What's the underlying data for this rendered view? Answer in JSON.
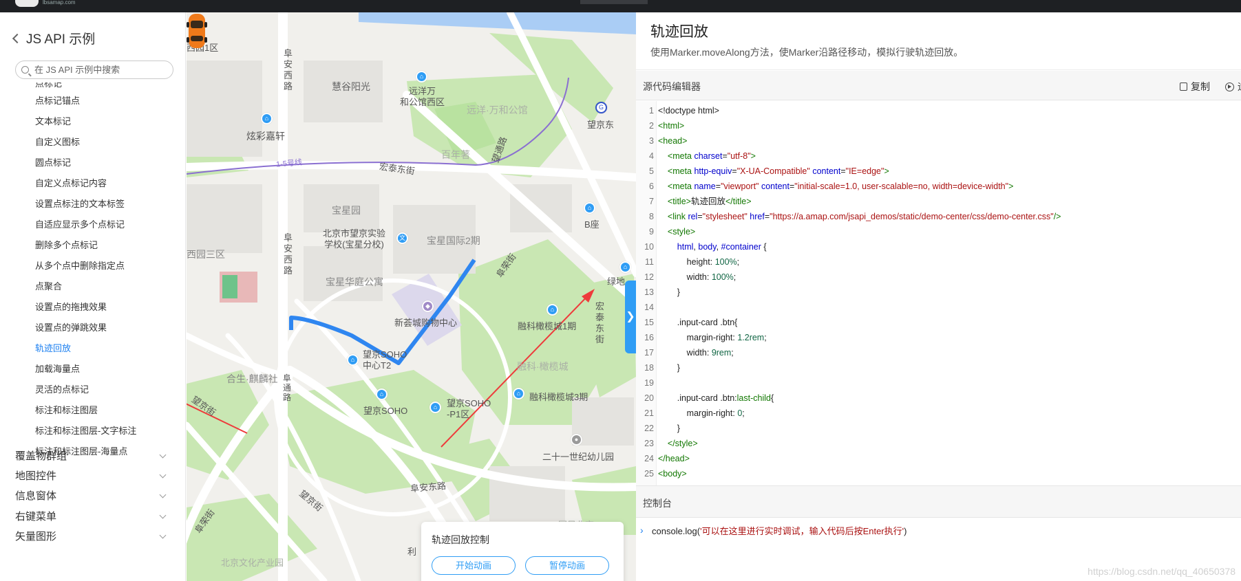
{
  "topbar": {
    "logo_text": "lbsamap.com"
  },
  "sidebar": {
    "back_title": "JS API 示例",
    "search_placeholder": "在 JS API 示例中搜索",
    "partial_item": "点标记",
    "items": [
      {
        "label": "点标记锚点"
      },
      {
        "label": "文本标记"
      },
      {
        "label": "自定义图标"
      },
      {
        "label": "圆点标记"
      },
      {
        "label": "自定义点标记内容"
      },
      {
        "label": "设置点标注的文本标签"
      },
      {
        "label": "自适应显示多个点标记"
      },
      {
        "label": "删除多个点标记"
      },
      {
        "label": "从多个点中删除指定点"
      },
      {
        "label": "点聚合"
      },
      {
        "label": "设置点的拖拽效果"
      },
      {
        "label": "设置点的弹跳效果"
      },
      {
        "label": "轨迹回放",
        "active": true
      },
      {
        "label": "加载海量点"
      },
      {
        "label": "灵活的点标记"
      },
      {
        "label": "标注和标注图层"
      },
      {
        "label": "标注和标注图层-文字标注"
      },
      {
        "label": "标注和标注图层-海量点"
      }
    ],
    "groups": [
      "覆盖物群组",
      "地图控件",
      "信息窗体",
      "右键菜单",
      "矢量图形"
    ]
  },
  "map": {
    "labels": {
      "l1": "西园1区",
      "l2": "阜安西路",
      "l3": "慧谷阳光",
      "l4": "远洋万\n和公馆西区",
      "l5": "远洋·万和公馆",
      "l6": "望京东",
      "l7": "炫彩嘉轩",
      "l8": "百年著",
      "l9": "望通路",
      "l10": "1·5号线",
      "l11": "宏泰东街",
      "l12": "宝星园",
      "l13": "B座",
      "l14": "北京市望京实验\n学校(宝星分校)",
      "l15": "宝星国际2期",
      "l16": "西园三区",
      "l17": "阜安西路",
      "l18": "宝星华庭公寓",
      "l19": "阜荣街",
      "l20": "绿地",
      "l21": "新荟城购物中心",
      "l22": "融科橄榄城1期",
      "l23": "宏泰东街",
      "l24": "望京SOHO\n中心T2",
      "l25": "融科·橄榄城",
      "l26": "合生·麒麟社",
      "l27": "望京街",
      "l28": "阜通路",
      "l29": "望京SOHO",
      "l30": "望京SOHO\n-P1区",
      "l31": "融科橄榄城3期",
      "l32": "二十一世纪幼儿园",
      "l33": "阜安东路",
      "l34": "望京街",
      "l35": "阜荣街",
      "l36": "利",
      "l37": "北京文化产业园",
      "l38": "国风北京"
    },
    "control_card": {
      "title": "轨迹回放控制",
      "start_button": "开始动画",
      "pause_button": "暂停动画"
    }
  },
  "right": {
    "title": "轨迹回放",
    "description": "使用Marker.moveAlong方法，使Marker沿路径移动，模拟行驶轨迹回放。",
    "editor_label": "源代码编辑器",
    "copy_label": "复制",
    "run_label": "运",
    "console_label": "控制台",
    "console_prefix": "console.log(",
    "console_string": "'可以在这里进行实时调试，输入代码后按Enter执行'",
    "console_suffix": ")",
    "watermark": "https://blog.csdn.net/qq_40650378"
  },
  "code_lines": [
    [
      [
        "tk-txt",
        "<!doctype html>"
      ]
    ],
    [
      [
        "tk-tag",
        "<html>"
      ]
    ],
    [
      [
        "tk-tag",
        "<head>"
      ]
    ],
    [
      [
        "tk-txt",
        "    "
      ],
      [
        "tk-tag",
        "<meta "
      ],
      [
        "tk-attr",
        "charset"
      ],
      [
        "tk-txt",
        "="
      ],
      [
        "tk-str",
        "\"utf-8\""
      ],
      [
        "tk-tag",
        ">"
      ]
    ],
    [
      [
        "tk-txt",
        "    "
      ],
      [
        "tk-tag",
        "<meta "
      ],
      [
        "tk-attr",
        "http-equiv"
      ],
      [
        "tk-txt",
        "="
      ],
      [
        "tk-str",
        "\"X-UA-Compatible\""
      ],
      [
        "tk-txt",
        " "
      ],
      [
        "tk-attr",
        "content"
      ],
      [
        "tk-txt",
        "="
      ],
      [
        "tk-str",
        "\"IE=edge\""
      ],
      [
        "tk-tag",
        ">"
      ]
    ],
    [
      [
        "tk-txt",
        "    "
      ],
      [
        "tk-tag",
        "<meta "
      ],
      [
        "tk-attr",
        "name"
      ],
      [
        "tk-txt",
        "="
      ],
      [
        "tk-str",
        "\"viewport\""
      ],
      [
        "tk-txt",
        " "
      ],
      [
        "tk-attr",
        "content"
      ],
      [
        "tk-txt",
        "="
      ],
      [
        "tk-str",
        "\"initial-scale=1.0, user-scalable=no, width=device-width\""
      ],
      [
        "tk-tag",
        ">"
      ]
    ],
    [
      [
        "tk-txt",
        "    "
      ],
      [
        "tk-tag",
        "<title>"
      ],
      [
        "tk-txt",
        "轨迹回放"
      ],
      [
        "tk-tag",
        "</title>"
      ]
    ],
    [
      [
        "tk-txt",
        "    "
      ],
      [
        "tk-tag",
        "<link "
      ],
      [
        "tk-attr",
        "rel"
      ],
      [
        "tk-txt",
        "="
      ],
      [
        "tk-str",
        "\"stylesheet\""
      ],
      [
        "tk-txt",
        " "
      ],
      [
        "tk-attr",
        "href"
      ],
      [
        "tk-txt",
        "="
      ],
      [
        "tk-str",
        "\"https://a.amap.com/jsapi_demos/static/demo-center/css/demo-center.css\""
      ],
      [
        "tk-tag",
        "/>"
      ]
    ],
    [
      [
        "tk-txt",
        "    "
      ],
      [
        "tk-tag",
        "<style>"
      ]
    ],
    [
      [
        "tk-txt",
        "        "
      ],
      [
        "tk-attr",
        "html"
      ],
      [
        "tk-txt",
        ", "
      ],
      [
        "tk-attr",
        "body"
      ],
      [
        "tk-txt",
        ", "
      ],
      [
        "tk-id",
        "#container"
      ],
      [
        "tk-txt",
        " {"
      ]
    ],
    [
      [
        "tk-txt",
        "            height: "
      ],
      [
        "tk-num",
        "100%"
      ],
      [
        "tk-txt",
        ";"
      ]
    ],
    [
      [
        "tk-txt",
        "            width: "
      ],
      [
        "tk-num",
        "100%"
      ],
      [
        "tk-txt",
        ";"
      ]
    ],
    [
      [
        "tk-txt",
        "        }"
      ]
    ],
    [
      [
        "tk-txt",
        ""
      ]
    ],
    [
      [
        "tk-txt",
        "        .input-card .btn{"
      ]
    ],
    [
      [
        "tk-txt",
        "            margin-right: "
      ],
      [
        "tk-num",
        "1.2rem"
      ],
      [
        "tk-txt",
        ";"
      ]
    ],
    [
      [
        "tk-txt",
        "            width: "
      ],
      [
        "tk-num",
        "9rem"
      ],
      [
        "tk-txt",
        ";"
      ]
    ],
    [
      [
        "tk-txt",
        "        }"
      ]
    ],
    [
      [
        "tk-txt",
        ""
      ]
    ],
    [
      [
        "tk-txt",
        "        .input-card .btn:"
      ],
      [
        "tk-tag",
        "last-child"
      ],
      [
        "tk-txt",
        "{"
      ]
    ],
    [
      [
        "tk-txt",
        "            margin-right: "
      ],
      [
        "tk-num",
        "0"
      ],
      [
        "tk-txt",
        ";"
      ]
    ],
    [
      [
        "tk-txt",
        "        }"
      ]
    ],
    [
      [
        "tk-txt",
        "    "
      ],
      [
        "tk-tag",
        "</style>"
      ]
    ],
    [
      [
        "tk-tag",
        "</head>"
      ]
    ],
    [
      [
        "tk-tag",
        "<body>"
      ]
    ]
  ],
  "colors": {
    "accent": "#1b7ff0",
    "map_blue": "#2f9df5",
    "arrow_red": "#ee3b3b",
    "park_green": "#b9e2a0"
  }
}
